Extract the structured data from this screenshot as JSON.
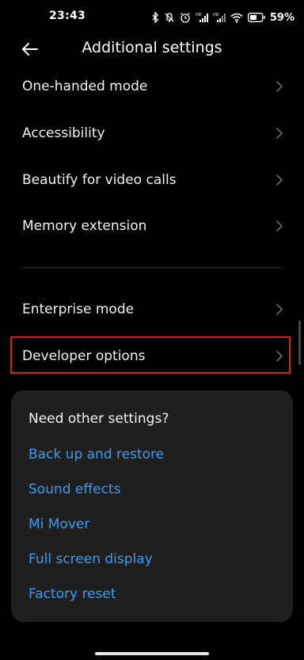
{
  "status_bar": {
    "time": "23:43",
    "battery": "59%",
    "icons": [
      "bluetooth-icon",
      "mute-icon",
      "alarm-icon",
      "hd-signal-icon",
      "hd-signal-icon",
      "wifi-icon",
      "battery-icon"
    ]
  },
  "header": {
    "title": "Additional settings",
    "back_icon": "back-arrow-icon"
  },
  "menu": {
    "items": [
      {
        "label": "One-handed mode"
      },
      {
        "label": "Accessibility"
      },
      {
        "label": "Beautify for video calls"
      },
      {
        "label": "Memory extension"
      },
      {
        "label": "Enterprise mode"
      },
      {
        "label": "Developer options"
      }
    ]
  },
  "suggestions": {
    "title": "Need other settings?",
    "links": [
      {
        "label": "Back up and restore"
      },
      {
        "label": "Sound effects"
      },
      {
        "label": "Mi Mover"
      },
      {
        "label": "Full screen display"
      },
      {
        "label": "Factory reset"
      }
    ]
  },
  "colors": {
    "background": "#000000",
    "card": "#1f1f1f",
    "link": "#3d9cf2",
    "highlight": "#d0202a"
  }
}
